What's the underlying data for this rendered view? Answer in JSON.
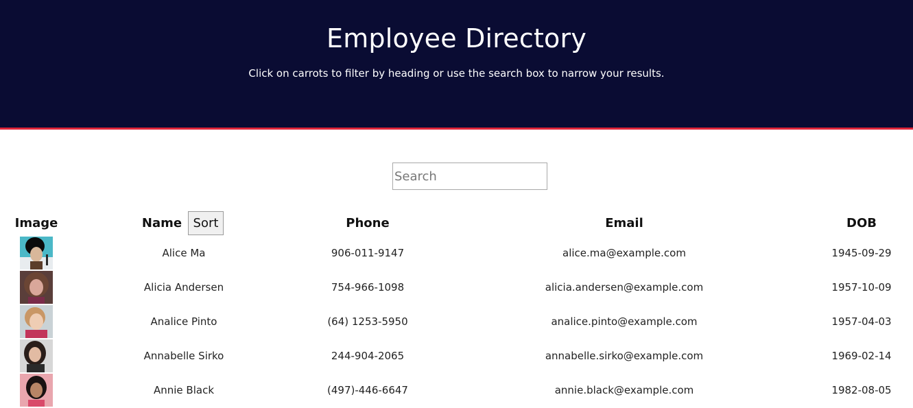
{
  "header": {
    "title": "Employee Directory",
    "subtitle": "Click on carrots to filter by heading or use the search box to narrow your results.",
    "background_color": "#0a0c33",
    "accent_color": "#e0263a"
  },
  "search": {
    "placeholder": "Search",
    "value": ""
  },
  "table": {
    "headers": {
      "image": "Image",
      "name": "Name",
      "phone": "Phone",
      "email": "Email",
      "dob": "DOB"
    },
    "sort_label": "Sort",
    "rows": [
      {
        "name": "Alice Ma",
        "phone": "906-011-9147",
        "email": "alice.ma@example.com",
        "dob": "1945-09-29"
      },
      {
        "name": "Alicia Andersen",
        "phone": "754-966-1098",
        "email": "alicia.andersen@example.com",
        "dob": "1957-10-09"
      },
      {
        "name": "Analice Pinto",
        "phone": "(64) 1253-5950",
        "email": "analice.pinto@example.com",
        "dob": "1957-04-03"
      },
      {
        "name": "Annabelle Sirko",
        "phone": "244-904-2065",
        "email": "annabelle.sirko@example.com",
        "dob": "1969-02-14"
      },
      {
        "name": "Annie Black",
        "phone": "(497)-446-6647",
        "email": "annie.black@example.com",
        "dob": "1982-08-05"
      }
    ]
  }
}
